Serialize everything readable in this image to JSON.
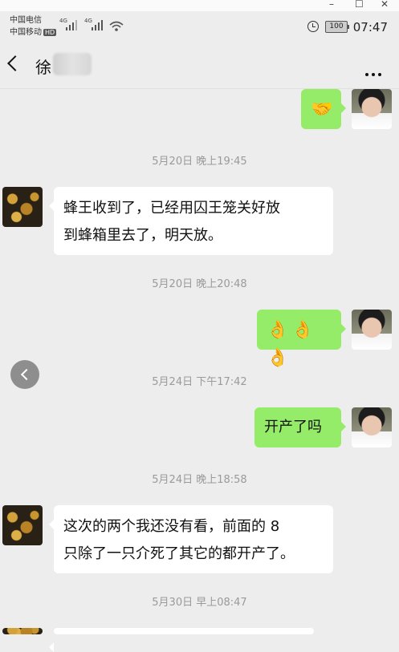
{
  "window": {
    "controls": [
      "–",
      "☐",
      "✕"
    ]
  },
  "status_bar": {
    "carrier_1": "中国电信",
    "carrier_2": "中国移动",
    "hd": "HD",
    "net_1": "4G",
    "net_2": "4G",
    "battery": "100",
    "time": "07:47",
    "icons": [
      "signal-icon",
      "wifi-icon",
      "alarm-icon",
      "battery-icon"
    ]
  },
  "nav": {
    "title": "徐",
    "back_icon": "chevron-left-icon",
    "more_icon": "more-dots-icon"
  },
  "messages": [
    {
      "type": "sent",
      "emoji": "🤝"
    },
    {
      "type": "time",
      "text": "5月20日 晚上19:45"
    },
    {
      "type": "received",
      "line1": "蜂王收到了，已经用囚王笼关好放",
      "line2": "到蜂箱里去了，明天放。"
    },
    {
      "type": "time",
      "text": "5月20日 晚上20:48"
    },
    {
      "type": "sent",
      "emoji": "👌👌👌"
    },
    {
      "type": "time",
      "text": "5月24日 下午17:42"
    },
    {
      "type": "sent",
      "text": "开产了吗"
    },
    {
      "type": "time",
      "text": "5月24日 晚上18:58"
    },
    {
      "type": "received",
      "line1": "这次的两个我还没有看，前面的 8",
      "line2": "只除了一只介死了其它的都开产了。"
    },
    {
      "type": "time",
      "text": "5月30日 早上08:47"
    }
  ],
  "colors": {
    "sent_bubble": "#95ec69",
    "received_bubble": "#ffffff",
    "background": "#ededed",
    "timestamp": "#9a9a9a"
  }
}
